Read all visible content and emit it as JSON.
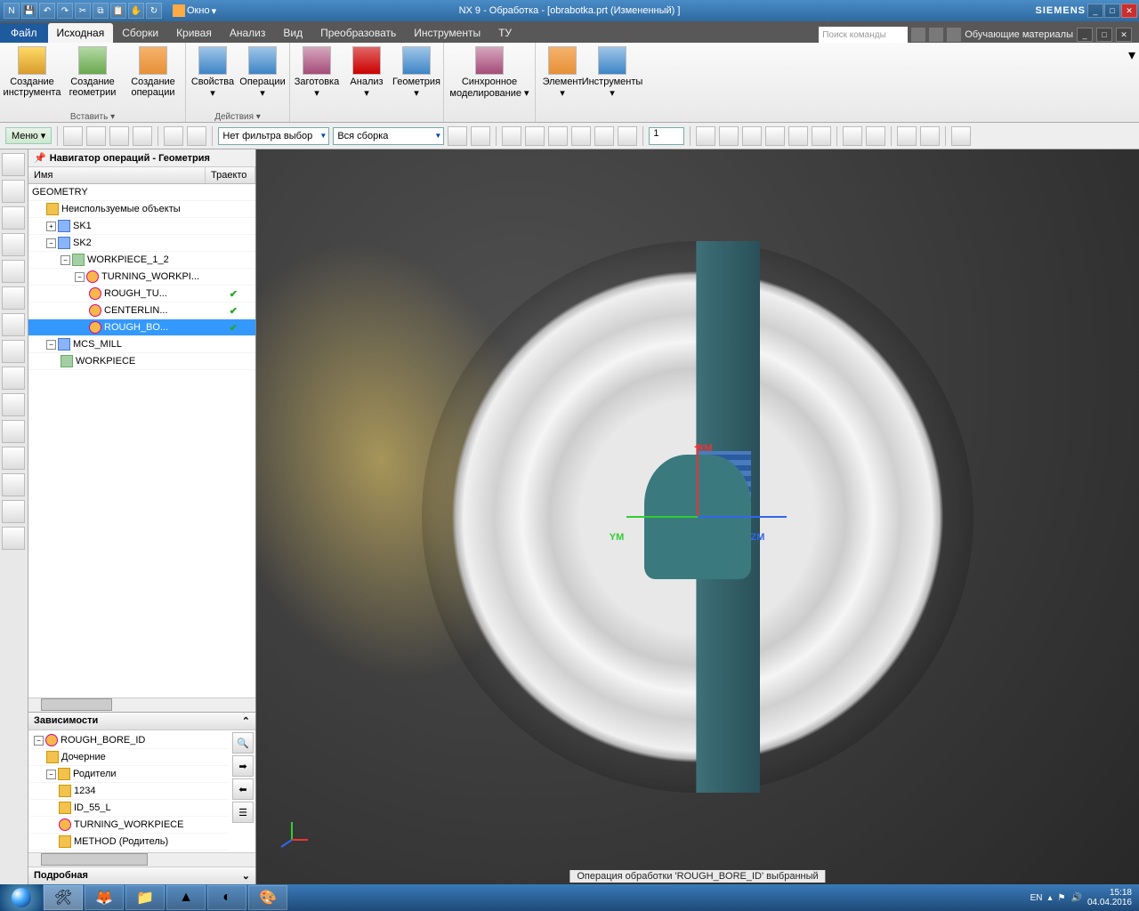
{
  "titlebar": {
    "window_menu": "Окно",
    "title": "NX 9 - Обработка - [obrabotka.prt (Измененный) ]",
    "brand": "SIEMENS"
  },
  "menu": {
    "file": "Файл",
    "tabs": [
      "Исходная",
      "Сборки",
      "Кривая",
      "Анализ",
      "Вид",
      "Преобразовать",
      "Инструменты",
      "ТУ"
    ],
    "active_tab_index": 0,
    "search_placeholder": "Поиск команды",
    "learning": "Обучающие материалы"
  },
  "ribbon": {
    "groups": [
      {
        "label": "Вставить ▾",
        "items": [
          "Создание инструмента",
          "Создание геометрии",
          "Создание операции"
        ]
      },
      {
        "label": "Действия ▾",
        "items": [
          "Свойства",
          "Операции"
        ]
      },
      {
        "label": "",
        "items": [
          "Заготовка",
          "Анализ",
          "Геометрия"
        ]
      },
      {
        "label": "",
        "items": [
          "Синхронное моделирование ▾"
        ]
      },
      {
        "label": "",
        "items": [
          "Элемент",
          "Инструменты"
        ]
      }
    ]
  },
  "toolrow": {
    "menu": "Меню ▾",
    "filter1": "Нет фильтра выбор",
    "filter2": "Вся сборка",
    "num": "1"
  },
  "navigator": {
    "title": "Навигатор операций - Геометрия",
    "cols": [
      "Имя",
      "Траекто"
    ],
    "tree": [
      {
        "depth": 0,
        "text": "GEOMETRY",
        "icon": "",
        "expand": ""
      },
      {
        "depth": 1,
        "text": "Неиспользуемые объекты",
        "icon": "folder",
        "expand": ""
      },
      {
        "depth": 1,
        "text": "SK1",
        "icon": "mcs",
        "expand": "+"
      },
      {
        "depth": 1,
        "text": "SK2",
        "icon": "mcs",
        "expand": "−"
      },
      {
        "depth": 2,
        "text": "WORKPIECE_1_2",
        "icon": "wp",
        "expand": "−"
      },
      {
        "depth": 3,
        "text": "TURNING_WORKPI...",
        "icon": "op",
        "expand": "−"
      },
      {
        "depth": 4,
        "text": "ROUGH_TU...",
        "icon": "op",
        "check": true
      },
      {
        "depth": 4,
        "text": "CENTERLIN...",
        "icon": "op",
        "check": true
      },
      {
        "depth": 4,
        "text": "ROUGH_BO...",
        "icon": "op",
        "check": true,
        "selected": true
      },
      {
        "depth": 1,
        "text": "MCS_MILL",
        "icon": "mcs",
        "expand": "−"
      },
      {
        "depth": 2,
        "text": "WORKPIECE",
        "icon": "wp"
      }
    ]
  },
  "dependencies": {
    "title": "Зависимости",
    "tree": [
      {
        "depth": 0,
        "text": "ROUGH_BORE_ID",
        "expand": "−",
        "icon": "op"
      },
      {
        "depth": 1,
        "text": "Дочерние",
        "icon": "folder"
      },
      {
        "depth": 1,
        "text": "Родители",
        "expand": "−",
        "icon": "folder"
      },
      {
        "depth": 2,
        "text": "1234",
        "icon": "file"
      },
      {
        "depth": 2,
        "text": "ID_55_L",
        "icon": "file"
      },
      {
        "depth": 2,
        "text": "TURNING_WORKPIECE",
        "icon": "op"
      },
      {
        "depth": 2,
        "text": "METHOD (Родитель)",
        "icon": "file"
      }
    ]
  },
  "detail_title": "Подробная",
  "viewport": {
    "axis_x": "XM",
    "axis_y": "YM",
    "axis_z": "ZM",
    "status": "Операция обработки 'ROUGH_BORE_ID' выбранный"
  },
  "tray": {
    "lang": "EN",
    "time": "15:18",
    "date": "04.04.2016"
  }
}
